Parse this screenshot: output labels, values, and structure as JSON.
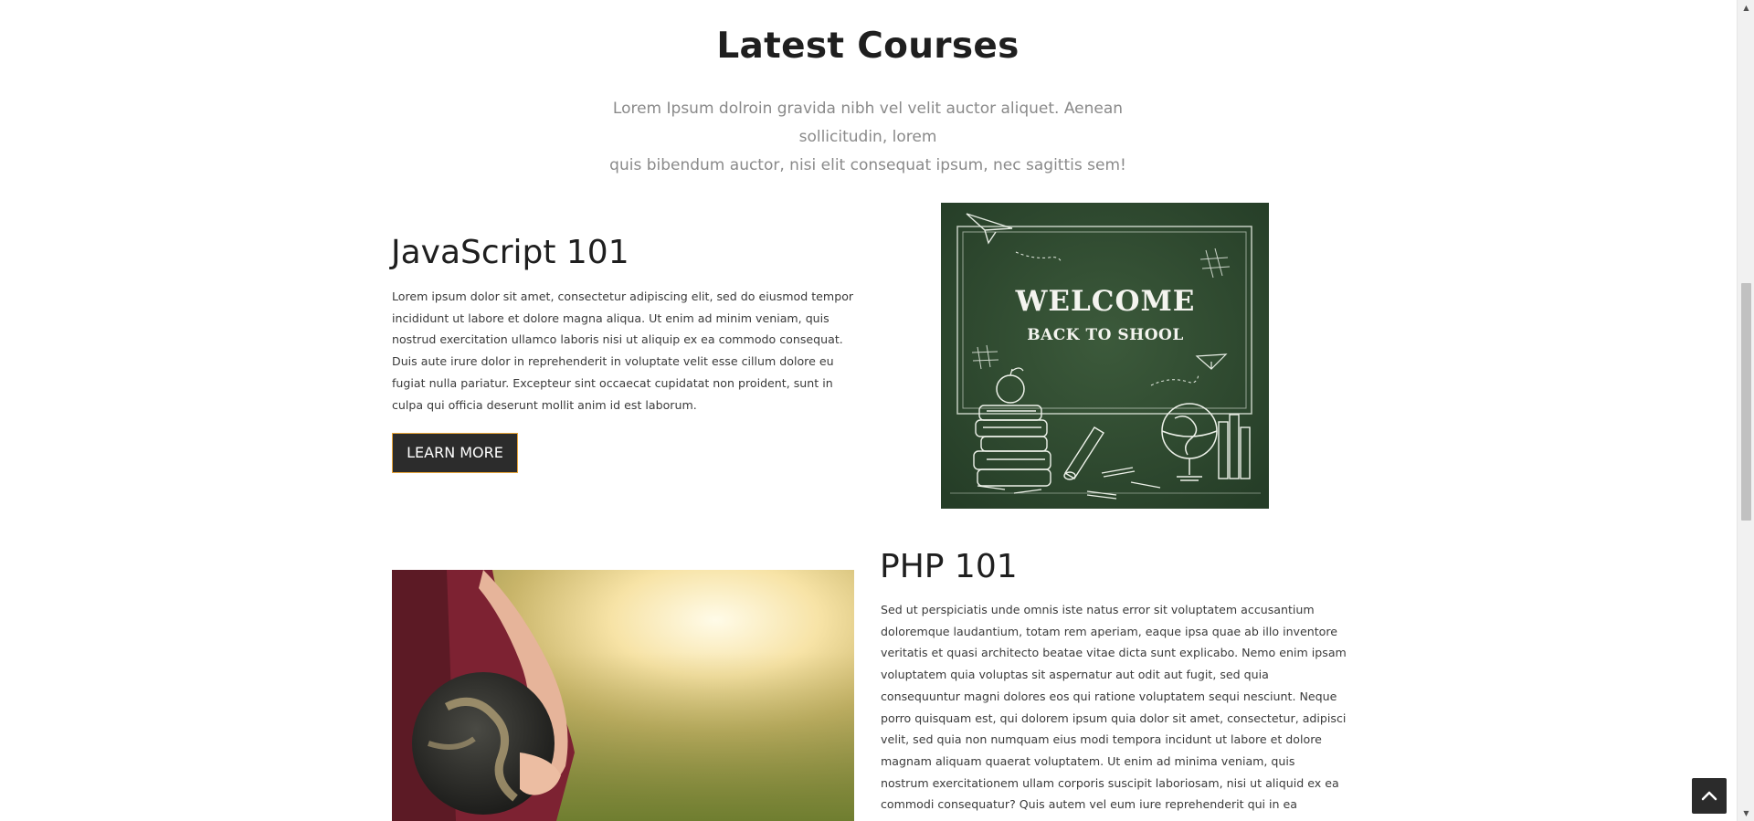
{
  "section": {
    "title": "Latest Courses",
    "subtitle_line1": "Lorem Ipsum dolroin gravida nibh vel velit auctor aliquet. Aenean sollicitudin, lorem",
    "subtitle_line2": "quis bibendum auctor, nisi elit consequat ipsum, nec sagittis sem!"
  },
  "courses": [
    {
      "title": "JavaScript 101",
      "description": "Lorem ipsum dolor sit amet, consectetur adipiscing elit, sed do eiusmod tempor incididunt ut labore et dolore magna aliqua. Ut enim ad minim veniam, quis nostrud exercitation ullamco laboris nisi ut aliquip ex ea commodo consequat. Duis aute irure dolor in reprehenderit in voluptate velit esse cillum dolore eu fugiat nulla pariatur. Excepteur sint occaecat cupidatat non proident, sunt in culpa qui officia deserunt mollit anim id est laborum.",
      "button_label": "LEARN MORE",
      "image": {
        "line1": "WELCOME",
        "line2": "BACK TO SHOOL"
      }
    },
    {
      "title": "PHP 101",
      "description": "Sed ut perspiciatis unde omnis iste natus error sit voluptatem accusantium doloremque laudantium, totam rem aperiam, eaque ipsa quae ab illo inventore veritatis et quasi architecto beatae vitae dicta sunt explicabo. Nemo enim ipsam voluptatem quia voluptas sit aspernatur aut odit aut fugit, sed quia consequuntur magni dolores eos qui ratione voluptatem sequi nesciunt. Neque porro quisquam est, qui dolorem ipsum quia dolor sit amet, consectetur, adipisci velit, sed quia non numquam eius modi tempora incidunt ut labore et dolore magnam aliquam quaerat voluptatem. Ut enim ad minima veniam, quis nostrum exercitationem ullam corporis suscipit laboriosam, nisi ut aliquid ex ea commodi consequatur? Quis autem vel eum iure reprehenderit qui in ea voluptate velit esse quam nihil"
    }
  ],
  "colors": {
    "button_bg": "#2c2c2c",
    "button_border": "#e8a53a",
    "chalkboard": "#2f4a30"
  },
  "icons": {
    "back_to_top": "chevron-up-icon"
  }
}
